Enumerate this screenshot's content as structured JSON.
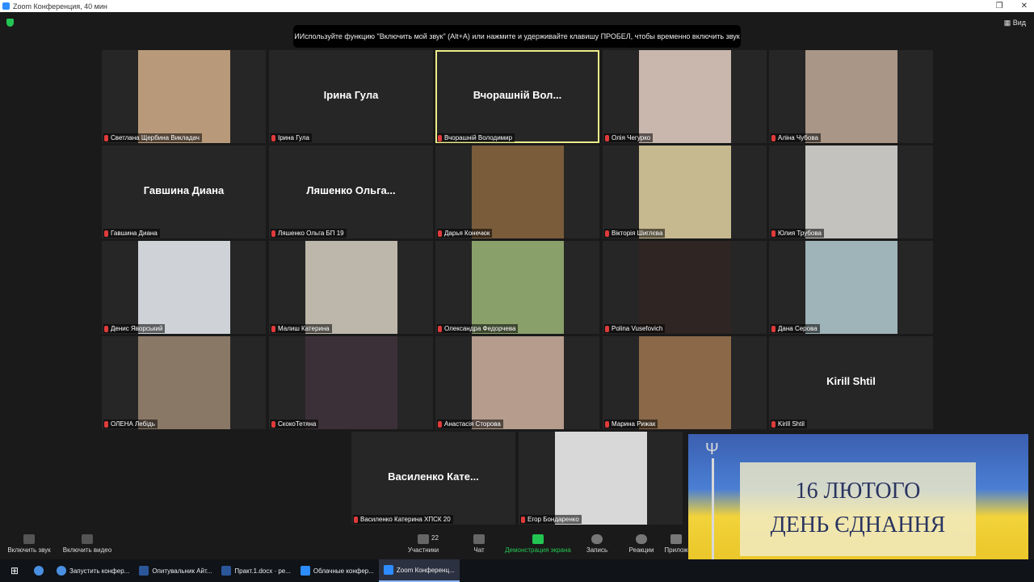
{
  "window": {
    "title": "Zoom Конференция, 40 мин"
  },
  "banner_notice": "ИИспользуйте функцию \"Включить мой звук\" (Alt+A) или нажмите и удерживайте клавишу ПРОБЕЛ, чтобы временно включить звук",
  "view_label": "Вид",
  "participants": [
    {
      "name": "Светлана Щербина Викладач",
      "display": "",
      "photo": "#b89a7a"
    },
    {
      "name": "Ірина Гула",
      "display": "Ірина Гула",
      "photo": ""
    },
    {
      "name": "Вчорашній Володимир",
      "display": "Вчорашній Вол...",
      "photo": ""
    },
    {
      "name": "Олія Чегурко",
      "display": "",
      "photo": "#c9b7ad"
    },
    {
      "name": "Аліна Чубова",
      "display": "",
      "photo": "#a99686"
    },
    {
      "name": "Гавшина Диана",
      "display": "Гавшина Диана",
      "photo": ""
    },
    {
      "name": "Ляшенко Ольга БП 19",
      "display": "Ляшенко Ольга...",
      "photo": ""
    },
    {
      "name": "Дарья Конечюк",
      "display": "",
      "photo": "#7a5c3a"
    },
    {
      "name": "Вікторія Шиглєва",
      "display": "",
      "photo": "#c7b98f"
    },
    {
      "name": "Юлия Трубова",
      "display": "",
      "photo": "#c3c2bf"
    },
    {
      "name": "Денис Яворський",
      "display": "",
      "photo": "#cfd3d8"
    },
    {
      "name": "Малиш Катерина",
      "display": "",
      "photo": "#bdb6aa"
    },
    {
      "name": "Олександра Федорчева",
      "display": "",
      "photo": "#8aa06a"
    },
    {
      "name": "Polina Vusefovich",
      "display": "",
      "photo": "#2f2522"
    },
    {
      "name": "Дана Серова",
      "display": "",
      "photo": "#9fb4b8"
    },
    {
      "name": "ОЛЕНА Лебідь",
      "display": "",
      "photo": "#8a7866"
    },
    {
      "name": "СкокоТетяна",
      "display": "",
      "photo": "#3b3037"
    },
    {
      "name": "Анастасія Сторова",
      "display": "",
      "photo": "#b59c8d"
    },
    {
      "name": "Марина Рижак",
      "display": "",
      "photo": "#8a6848"
    },
    {
      "name": "Kirill Shtil",
      "display": "Kirill Shtil",
      "photo": ""
    },
    {
      "name": "Василенко Катерина ХПСК 20",
      "display": "Василенко Кате...",
      "photo": ""
    },
    {
      "name": "Егор Бондаренко",
      "display": "",
      "photo": "#d8d8d8"
    }
  ],
  "overlay_image": {
    "line1": "16 ЛЮТОГО",
    "line2": "ДЕНЬ ЄДНАННЯ"
  },
  "toolbar": {
    "unmute": "Включить звук",
    "video": "Включить видео",
    "participants": "Участники",
    "participants_count": "22",
    "chat": "Чат",
    "share": "Демонстрация экрана",
    "record": "Запись",
    "reactions": "Реакции",
    "apps": "Прилож"
  },
  "taskbar": {
    "items": [
      "Запустить конфер...",
      "Опитувальник Айт...",
      "Практ.1.docx · ре...",
      "Облачные конфер...",
      "Zoom Конференц..."
    ]
  },
  "colors": {
    "active_speaker": "#ecec8a",
    "share_green": "#23c552",
    "mic_muted": "#e03b3b"
  }
}
